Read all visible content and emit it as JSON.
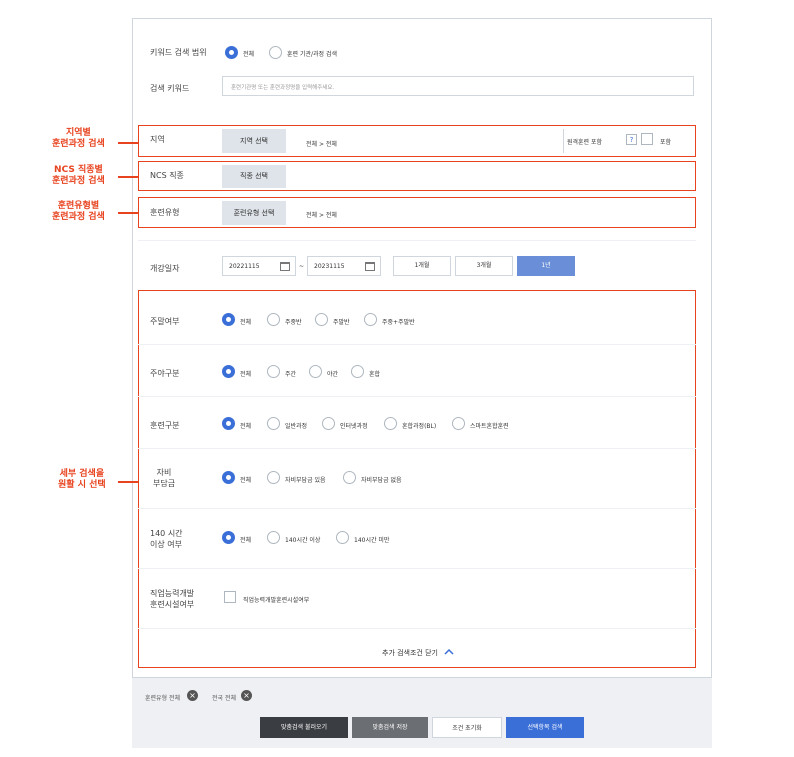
{
  "keyword_scope": {
    "label": "키워드 검색 범위",
    "options": [
      "전체",
      "훈련 기관/과정 검색"
    ],
    "selected": 0
  },
  "keyword": {
    "label": "검색 키워드",
    "placeholder": "훈련기관명 또는 훈련과정명을 입력해주세요."
  },
  "region": {
    "label": "지역",
    "button": "지역 선택",
    "value": "전체 > 전체",
    "remote_label": "원격훈련 포함",
    "help": "?",
    "include_label": "포함"
  },
  "ncs": {
    "label": "NCS 직종",
    "button": "직종 선택"
  },
  "training_type": {
    "label": "훈련유형",
    "button": "훈련유형 선택",
    "value": "전체 > 전체"
  },
  "start_date": {
    "label": "개강일자",
    "from": "20221115",
    "tilde": "~",
    "to": "20231115",
    "periods": [
      "1개월",
      "3개월",
      "1년"
    ],
    "selected_period": 2
  },
  "weekend": {
    "label": "주말여부",
    "options": [
      "전체",
      "주중반",
      "주말반",
      "주중+주말반"
    ],
    "selected": 0
  },
  "daynight": {
    "label": "주야구분",
    "options": [
      "전체",
      "주간",
      "야간",
      "혼합"
    ],
    "selected": 0
  },
  "course_kind": {
    "label": "훈련구분",
    "options": [
      "전체",
      "일반과정",
      "인터넷과정",
      "혼합과정(BL)",
      "스마트혼합훈련"
    ],
    "selected": 0
  },
  "self_pay": {
    "label_line1": "자비",
    "label_line2": "부담금",
    "options": [
      "전체",
      "자비부담금 있음",
      "자비부담금 없음"
    ],
    "selected": 0
  },
  "hours140": {
    "label_line1": "140 시간",
    "label_line2": "이상 여부",
    "options": [
      "전체",
      "140시간 이상",
      "140시간 미만"
    ],
    "selected": 0
  },
  "facility": {
    "label_line1": "직업능력개발",
    "label_line2": "훈련시설여부",
    "checkbox_label": "직업능력개발훈련시설여부"
  },
  "close_more": {
    "label": "추가 검색조건 닫기",
    "icon": "chevron-up-icon"
  },
  "annotations": {
    "region": [
      "지역별",
      "훈련과정 검색"
    ],
    "ncs": [
      "NCS 직종별",
      "훈련과정 검색"
    ],
    "type": [
      "훈련유형별",
      "훈련과정 검색"
    ],
    "detail": [
      "세부 검색을",
      "원활 시 선택"
    ]
  },
  "chips": [
    "훈련유형 전체",
    "전국 전체"
  ],
  "actions": {
    "load": "맞춤검색 불러오기",
    "save": "맞춤검색 저장",
    "reset": "조건 초기화",
    "search": "선택항목 검색"
  },
  "colors": {
    "accent": "#3b6fd8",
    "annotation": "#e8431f",
    "dark_button": "#3a3d42",
    "mid_button": "#6b6e72"
  }
}
